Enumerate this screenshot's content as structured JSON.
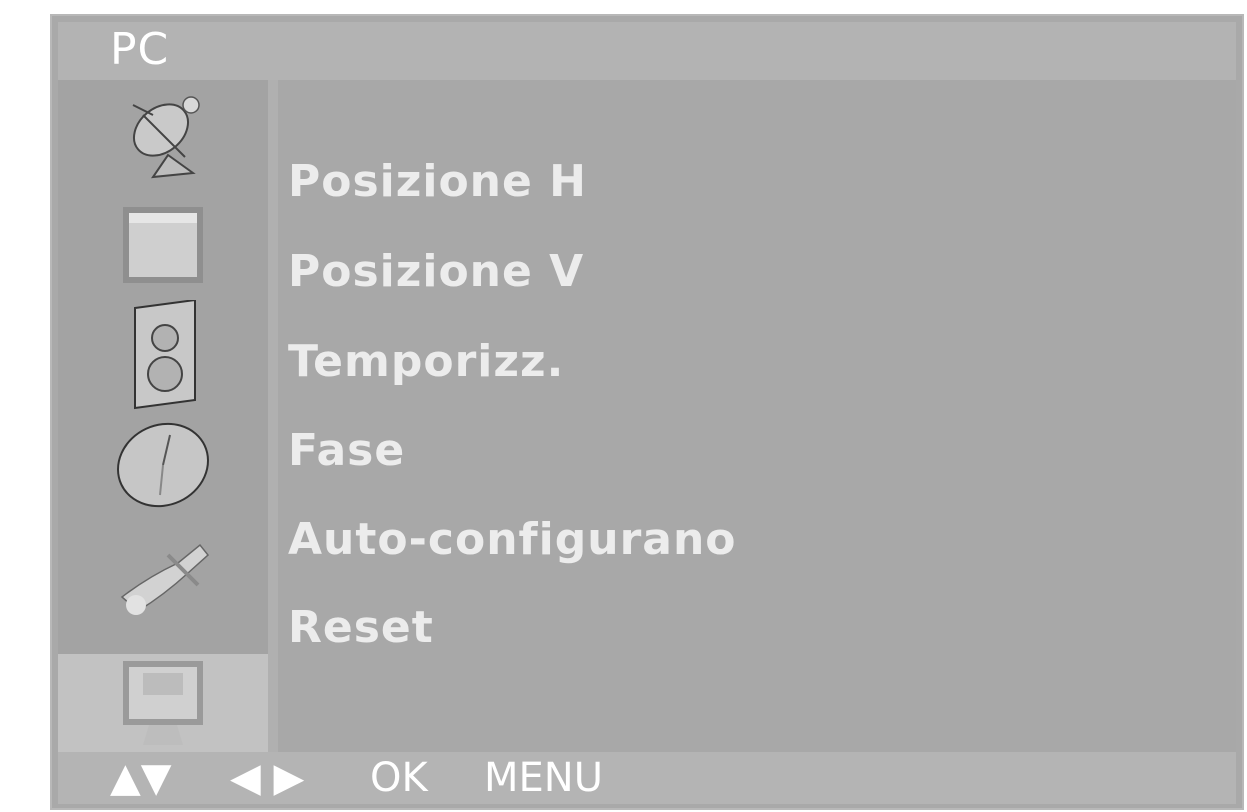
{
  "header": {
    "title": "PC"
  },
  "sidebar": {
    "items": [
      {
        "icon": "satellite-dish-icon",
        "active": false
      },
      {
        "icon": "picture-icon",
        "active": false
      },
      {
        "icon": "speaker-icon",
        "active": false
      },
      {
        "icon": "clock-icon",
        "active": false
      },
      {
        "icon": "tools-icon",
        "active": false
      },
      {
        "icon": "pc-monitor-icon",
        "active": true
      }
    ]
  },
  "menu": {
    "items": [
      {
        "label": "Posizione H"
      },
      {
        "label": "Posizione V"
      },
      {
        "label": "Temporizz."
      },
      {
        "label": "Fase"
      },
      {
        "label": "Auto-configurano"
      },
      {
        "label": "Reset"
      }
    ]
  },
  "footer": {
    "up_down": "▲▼",
    "left_right": "◀ ▶",
    "ok": "OK",
    "menu": "MENU"
  }
}
